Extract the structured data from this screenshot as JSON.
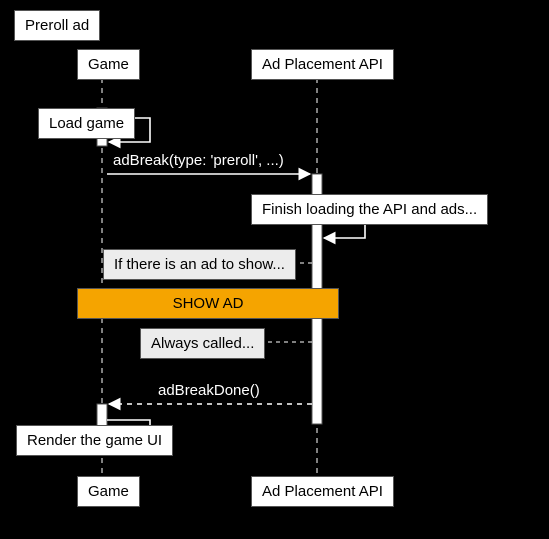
{
  "title": "Preroll ad",
  "participants": {
    "game": "Game",
    "api": "Ad Placement API"
  },
  "steps": {
    "load_game": "Load game",
    "adbreak_call": "adBreak(type: 'preroll', ...)",
    "finish_loading": "Finish loading the API and ads...",
    "if_ad": "If there is an ad to show...",
    "show_ad": "SHOW AD",
    "always_called": "Always called...",
    "adbreak_done": "adBreakDone()",
    "render_ui": "Render the game UI"
  }
}
